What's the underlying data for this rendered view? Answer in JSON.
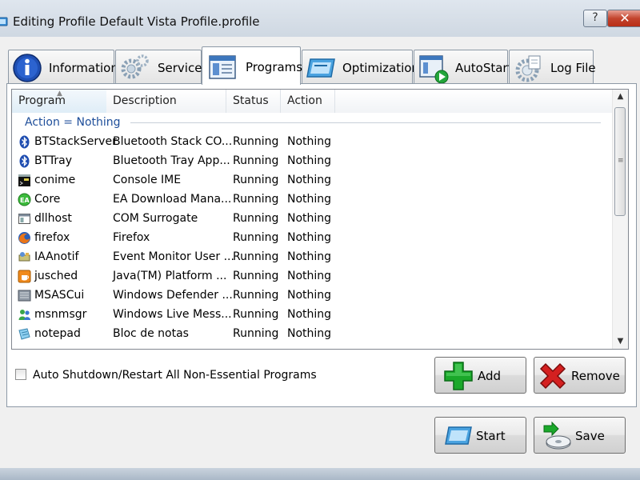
{
  "window": {
    "title": "Editing Profile Default Vista Profile.profile",
    "help_label": "?",
    "close_label": "✕"
  },
  "tabs": [
    {
      "label": "Information",
      "icon": "info-icon",
      "active": false
    },
    {
      "label": "Services",
      "icon": "gears-icon",
      "active": false
    },
    {
      "label": "Programs",
      "icon": "programs-window-icon",
      "active": true
    },
    {
      "label": "Optimization",
      "icon": "optimization-icon",
      "active": false
    },
    {
      "label": "AutoStart",
      "icon": "autostart-icon",
      "active": false
    },
    {
      "label": "Log File",
      "icon": "log-file-icon",
      "active": false
    }
  ],
  "list": {
    "columns": [
      "Program",
      "Description",
      "Status",
      "Action"
    ],
    "sorted_column": "Program",
    "group_label": "Action = Nothing",
    "rows": [
      {
        "program": "BTStackServer",
        "description": "Bluetooth Stack CO...",
        "status": "Running",
        "action": "Nothing",
        "icon": "bluetooth-icon"
      },
      {
        "program": "BTTray",
        "description": "Bluetooth Tray App...",
        "status": "Running",
        "action": "Nothing",
        "icon": "bluetooth-icon"
      },
      {
        "program": "conime",
        "description": "Console IME",
        "status": "Running",
        "action": "Nothing",
        "icon": "console-icon"
      },
      {
        "program": "Core",
        "description": "EA Download Mana...",
        "status": "Running",
        "action": "Nothing",
        "icon": "ea-icon"
      },
      {
        "program": "dllhost",
        "description": "COM Surrogate",
        "status": "Running",
        "action": "Nothing",
        "icon": "app-window-icon"
      },
      {
        "program": "firefox",
        "description": "Firefox",
        "status": "Running",
        "action": "Nothing",
        "icon": "firefox-icon"
      },
      {
        "program": "IAAnotif",
        "description": "Event Monitor User ...",
        "status": "Running",
        "action": "Nothing",
        "icon": "storage-icon"
      },
      {
        "program": "jusched",
        "description": "Java(TM) Platform ...",
        "status": "Running",
        "action": "Nothing",
        "icon": "java-icon"
      },
      {
        "program": "MSASCui",
        "description": "Windows Defender ...",
        "status": "Running",
        "action": "Nothing",
        "icon": "defender-icon"
      },
      {
        "program": "msnmsgr",
        "description": "Windows Live Mess...",
        "status": "Running",
        "action": "Nothing",
        "icon": "messenger-icon"
      },
      {
        "program": "notepad",
        "description": "Bloc de notas",
        "status": "Running",
        "action": "Nothing",
        "icon": "notepad-icon"
      }
    ]
  },
  "auto_shutdown": {
    "label": "Auto Shutdown/Restart All Non-Essential Programs",
    "checked": false
  },
  "buttons": {
    "add": "Add",
    "remove": "Remove",
    "start": "Start",
    "save": "Save"
  },
  "colors": {
    "group_text": "#1e4e9a",
    "add_green": "#1aa82a",
    "remove_red": "#d42020"
  }
}
